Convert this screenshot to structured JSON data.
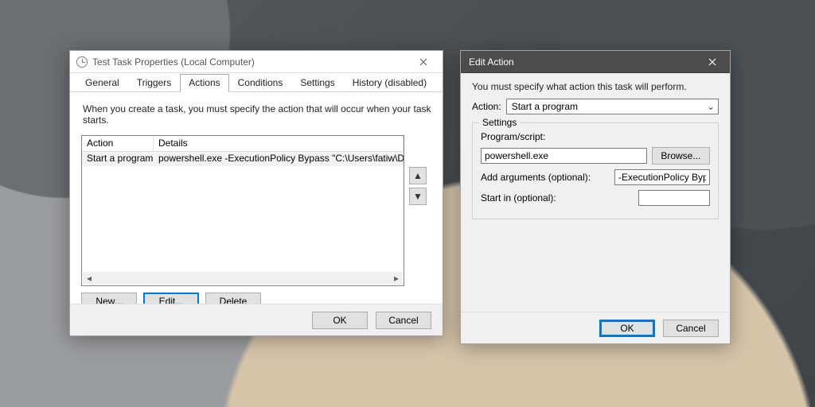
{
  "props_window": {
    "title": "Test Task Properties (Local Computer)",
    "tabs": [
      "General",
      "Triggers",
      "Actions",
      "Conditions",
      "Settings",
      "History (disabled)"
    ],
    "active_tab": "Actions",
    "hint": "When you create a task, you must specify the action that will occur when your task starts.",
    "columns": {
      "action": "Action",
      "details": "Details"
    },
    "rows": [
      {
        "action": "Start a program",
        "details": "powershell.exe -ExecutionPolicy Bypass \"C:\\Users\\fatiw\\Desktop\\endTask."
      }
    ],
    "buttons": {
      "new": "New...",
      "edit": "Edit...",
      "delete": "Delete"
    },
    "ok": "OK",
    "cancel": "Cancel",
    "arrow_up": "▲",
    "arrow_down": "▼"
  },
  "edit_action": {
    "title": "Edit Action",
    "desc": "You must specify what action this task will perform.",
    "action_label": "Action:",
    "action_value": "Start a program",
    "settings_legend": "Settings",
    "program_label": "Program/script:",
    "program_value": "powershell.exe",
    "browse": "Browse...",
    "args_label": "Add arguments (optional):",
    "args_value": "-ExecutionPolicy Bypass",
    "start_label": "Start in (optional):",
    "start_value": "",
    "ok": "OK",
    "cancel": "Cancel"
  }
}
